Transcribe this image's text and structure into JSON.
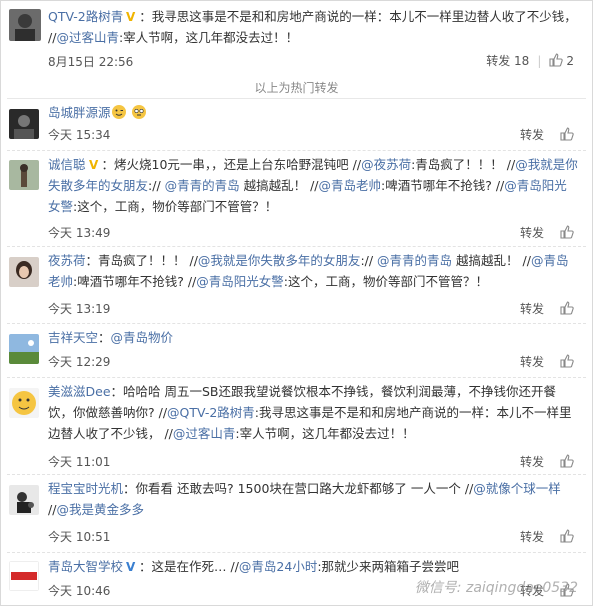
{
  "top_comment": {
    "user": "QTV-2路树青",
    "text": "：我寻思这事是不是和和房地产商说的一样：本儿不一样里边替人收了不少钱， //",
    "mention": "@过客山青",
    "text2": ":宰人节啊，这几年都没去过！！",
    "time": "8月15日 22:56",
    "repost_label": "转发",
    "repost_count": "18",
    "like_count": "2"
  },
  "hot_label": "以上为热门转发",
  "comments": [
    {
      "user": "岛城胖源源",
      "time": "今天 15:34",
      "repost": "转发"
    },
    {
      "user": "诚信聪",
      "seg1": "：烤火烧10元一串，，还是上台东哈野混钝吧 //",
      "m1": "@夜苏荷",
      "seg2": ":青岛疯了！！！ //",
      "m2": "@我就是你失散多年的女朋友",
      "seg3": ":// ",
      "m3": "@青青的青岛",
      "seg4": " 越搞越乱！ //",
      "m4": "@青岛老帅",
      "seg5": ":啤酒节哪年不抢钱? //",
      "m5": "@青岛阳光女警",
      "seg6": ":这个，工商，物价等部门不管管？！",
      "time": "今天 13:49",
      "repost": "转发"
    },
    {
      "user": "夜苏荷",
      "seg1": "：青岛疯了！！！ //",
      "m1": "@我就是你失散多年的女朋友",
      "seg2": ":// ",
      "m2": "@青青的青岛",
      "seg3": " 越搞越乱！ //",
      "m3": "@青岛老帅",
      "seg4": ":啤酒节哪年不抢钱? //",
      "m4": "@青岛阳光女警",
      "seg5": ":这个，工商，物价等部门不管管？！",
      "time": "今天 13:19",
      "repost": "转发"
    },
    {
      "user": "吉祥天空",
      "seg1": "：",
      "m1": "@青岛物价",
      "time": "今天 12:29",
      "repost": "转发"
    },
    {
      "user": "美滋滋Dee",
      "seg1": "：哈哈哈 周五一SB还跟我望说餐饮根本不挣钱，餐饮利润最薄，不挣钱你还开餐饮，你做慈善呐你? //",
      "m1": "@QTV-2路树青",
      "seg2": ":我寻思这事是不是和和房地产商说的一样：本儿不一样里边替人收了不少钱， //",
      "m2": "@过客山青",
      "seg3": ":宰人节啊，这几年都没去过！！",
      "time": "今天 11:01",
      "repost": "转发"
    },
    {
      "user": "程宝宝时光机",
      "seg1": "：你看看 还敢去吗? 1500块在营口路大龙虾都够了 一人一个 //",
      "m1": "@就像个球一样",
      "seg2": " //",
      "m2": "@我是黄金多多",
      "time": "今天 10:51",
      "repost": "转发"
    },
    {
      "user": "青岛大智学校",
      "seg1": "：这是在作死… //",
      "m1": "@青岛24小时",
      "seg2": ":那就少来两箱箱子尝尝吧",
      "time": "今天 10:46",
      "repost": "转发"
    }
  ],
  "watermark": "微信号: zaiqingdao0532",
  "icons": {
    "verified": "verified-badge-icon",
    "thumb": "thumbs-up-icon"
  },
  "colors": {
    "link": "#4a6fa5",
    "verified": "#f0b400"
  }
}
